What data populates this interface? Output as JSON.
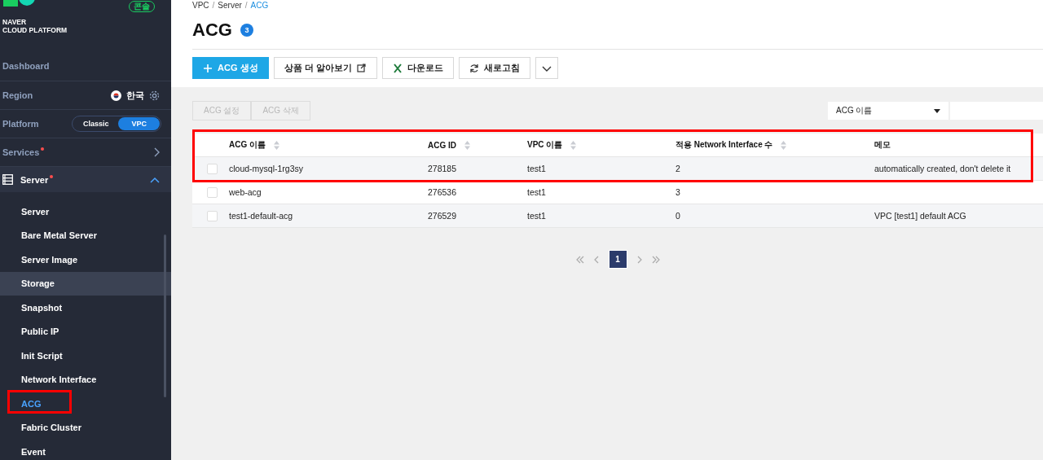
{
  "sidebar": {
    "logo": {
      "line1": "NAVER",
      "line2": "CLOUD PLATFORM"
    },
    "console_badge": "콘솔",
    "rows": [
      {
        "kind": "link",
        "label": "Dashboard"
      },
      {
        "kind": "region",
        "label": "Region",
        "value": "한국"
      },
      {
        "kind": "platform",
        "label": "Platform",
        "options": [
          {
            "label": "Classic",
            "selected": false
          },
          {
            "label": "VPC",
            "selected": true
          }
        ]
      },
      {
        "kind": "services",
        "label": "Services",
        "new": true
      },
      {
        "kind": "group",
        "label": "Server",
        "new": true,
        "expanded": true
      }
    ],
    "items": [
      {
        "label": "Server",
        "selected": false,
        "hovered": false,
        "annotated": false
      },
      {
        "label": "Bare Metal Server",
        "selected": false,
        "hovered": false,
        "annotated": false
      },
      {
        "label": "Server Image",
        "selected": false,
        "hovered": false,
        "annotated": false
      },
      {
        "label": "Storage",
        "selected": false,
        "hovered": true,
        "annotated": false
      },
      {
        "label": "Snapshot",
        "selected": false,
        "hovered": false,
        "annotated": false
      },
      {
        "label": "Public IP",
        "selected": false,
        "hovered": false,
        "annotated": false
      },
      {
        "label": "Init Script",
        "selected": false,
        "hovered": false,
        "annotated": false
      },
      {
        "label": "Network Interface",
        "selected": false,
        "hovered": false,
        "annotated": false
      },
      {
        "label": "ACG",
        "selected": true,
        "hovered": false,
        "annotated": true
      },
      {
        "label": "Fabric Cluster",
        "selected": false,
        "hovered": false,
        "annotated": false
      },
      {
        "label": "Event",
        "selected": false,
        "hovered": false,
        "annotated": false
      }
    ]
  },
  "breadcrumb": {
    "separator": "/",
    "items": [
      "VPC",
      "Server",
      "ACG"
    ]
  },
  "page": {
    "title": "ACG",
    "count": "3"
  },
  "toolbar": [
    {
      "kind": "create",
      "label": "ACG 생성"
    },
    {
      "kind": "learn",
      "label": "상품 더 알아보기"
    },
    {
      "kind": "download",
      "label": "다운로드"
    },
    {
      "kind": "refresh",
      "label": "새로고침"
    },
    {
      "kind": "more"
    }
  ],
  "actions": [
    {
      "label": "ACG 설정",
      "disabled": true
    },
    {
      "label": "ACG 삭제",
      "disabled": true
    }
  ],
  "filter": {
    "field": "ACG 이름"
  },
  "table": {
    "annotated": true,
    "columns": [
      {
        "label": "ACG 이름",
        "sortable": true
      },
      {
        "label": "ACG ID",
        "sortable": true
      },
      {
        "label": "VPC 이름",
        "sortable": true
      },
      {
        "label": "적용 Network Interface 수",
        "sortable": true
      },
      {
        "label": "메모",
        "sortable": false
      }
    ],
    "rows": [
      {
        "checked": false,
        "cells": [
          "cloud-mysql-1rg3sy",
          "278185",
          "test1",
          "2",
          "automatically created, don't delete it"
        ]
      },
      {
        "checked": false,
        "cells": [
          "web-acg",
          "276536",
          "test1",
          "3",
          ""
        ]
      },
      {
        "checked": false,
        "cells": [
          "test1-default-acg",
          "276529",
          "test1",
          "0",
          "VPC [test1] default ACG"
        ]
      }
    ]
  },
  "pagination": {
    "pages": [
      {
        "label": "1",
        "selected": true
      }
    ]
  }
}
